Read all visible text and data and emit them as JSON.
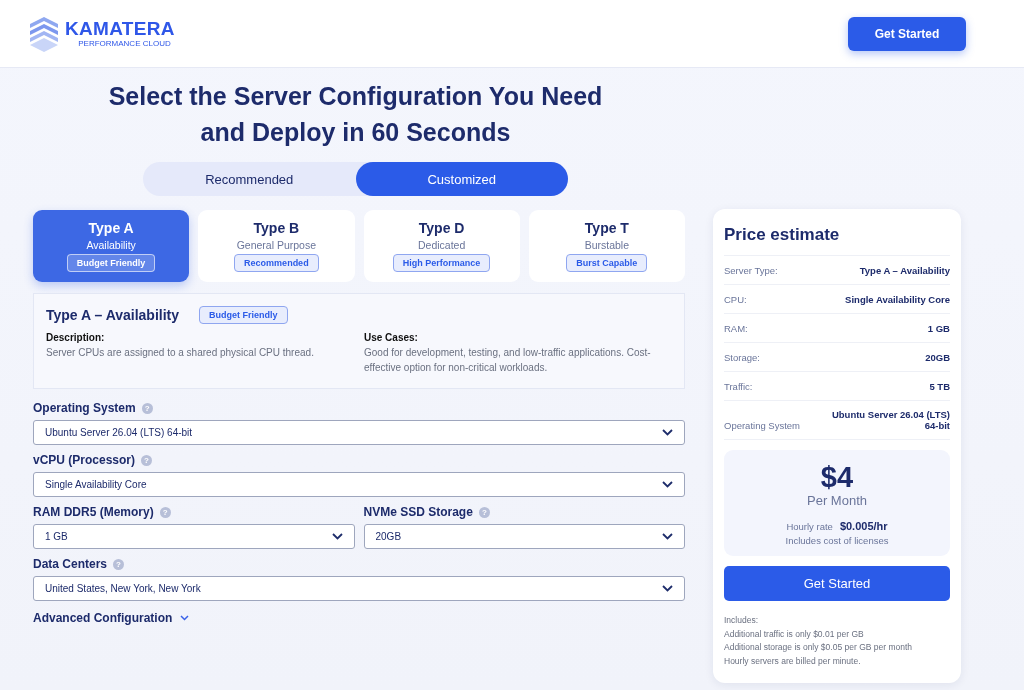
{
  "header": {
    "logo_name": "KAMATERA",
    "logo_tagline": "PERFORMANCE CLOUD",
    "cta": "Get Started"
  },
  "title_lines": [
    "Select the Server Configuration You Need",
    "and Deploy in 60 Seconds"
  ],
  "mode_tabs": [
    {
      "label": "Recommended",
      "selected": false
    },
    {
      "label": "Customized",
      "selected": true
    }
  ],
  "server_types": [
    {
      "name": "Type A",
      "subtitle": "Availability",
      "badge": "Budget Friendly",
      "selected": true
    },
    {
      "name": "Type B",
      "subtitle": "General Purpose",
      "badge": "Recommended",
      "selected": false
    },
    {
      "name": "Type D",
      "subtitle": "Dedicated",
      "badge": "High Performance",
      "selected": false
    },
    {
      "name": "Type T",
      "subtitle": "Burstable",
      "badge": "Burst Capable",
      "selected": false
    }
  ],
  "details": {
    "title": "Type A – Availability",
    "badge": "Budget Friendly",
    "columns": [
      {
        "heading": "Description:",
        "text": "Server CPUs are assigned to a shared physical CPU thread."
      },
      {
        "heading": "Use Cases:",
        "text": "Good for development, testing, and low-traffic applications. Cost-effective option for non-critical workloads."
      }
    ]
  },
  "field_rows": [
    [
      {
        "label": "Operating System",
        "help": "?",
        "value": "Ubuntu Server 26.04 (LTS) 64-bit"
      }
    ],
    [
      {
        "label": "vCPU (Processor)",
        "help": "?",
        "value": "Single Availability Core"
      }
    ],
    [
      {
        "label": "RAM DDR5 (Memory)",
        "help": "?",
        "value": "1 GB"
      },
      {
        "label": "NVMe SSD Storage",
        "help": "?",
        "value": "20GB"
      }
    ],
    [
      {
        "label": "Data Centers",
        "help": "?",
        "value": "United States, New York, New York"
      }
    ]
  ],
  "advanced": {
    "label": "Advanced Configuration",
    "expanded": false
  },
  "estimate": {
    "title": "Price estimate",
    "rows": [
      {
        "label": "Server Type:",
        "value": "Type A – Availability"
      },
      {
        "label": "CPU:",
        "value": "Single Availability Core"
      },
      {
        "label": "RAM:",
        "value": "1 GB"
      },
      {
        "label": "Storage:",
        "value": "20GB"
      },
      {
        "label": "Traffic:",
        "value": "5 TB"
      },
      {
        "label": "Operating System",
        "value": "Ubuntu Server 26.04 (LTS) 64-bit"
      }
    ],
    "price": "$4",
    "period": "Per Month",
    "hourly_label": "Hourly rate",
    "hourly_value": "$0.005/hr",
    "licenses": "Includes cost of licenses",
    "cta": "Get Started",
    "includes": [
      "Includes:",
      "Additional traffic is only $0.01 per GB",
      "Additional storage is only $0.05 per GB per month",
      "Hourly servers are billed per minute."
    ]
  }
}
